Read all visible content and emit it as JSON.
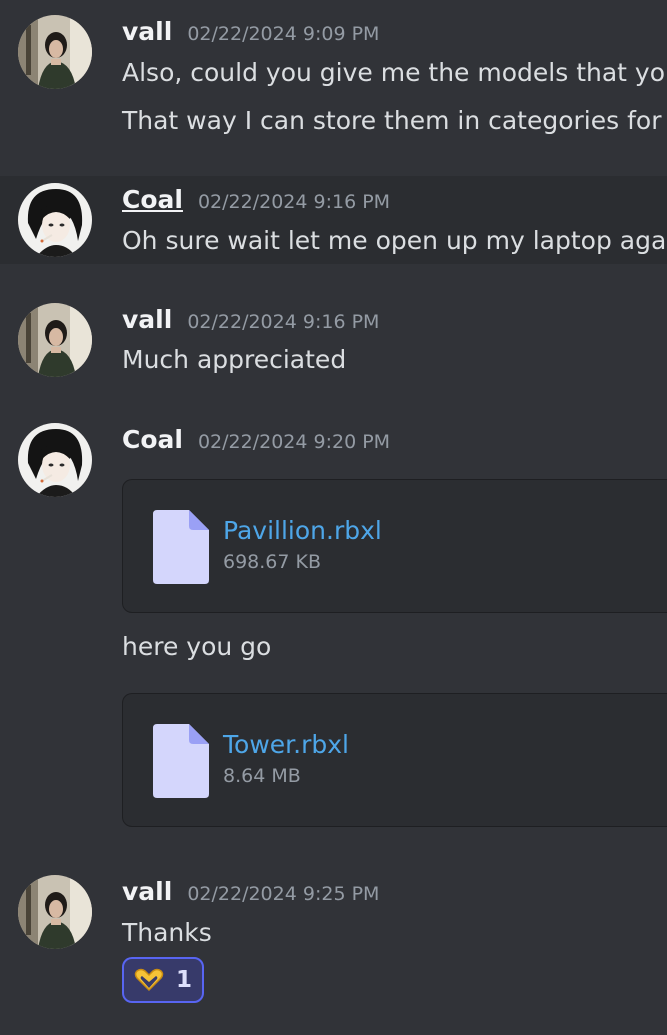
{
  "messages": [
    {
      "author": "vall",
      "timestamp": "02/22/2024 9:09 PM",
      "lines": [
        "Also, could you give me the models that you",
        "That way I can store them in categories for r"
      ]
    },
    {
      "author": "Coal",
      "timestamp": "02/22/2024 9:16 PM",
      "lines": [
        "Oh sure wait let me open up my laptop agair"
      ]
    },
    {
      "author": "vall",
      "timestamp": "02/22/2024 9:16 PM",
      "lines": [
        "Much appreciated"
      ]
    },
    {
      "author": "Coal",
      "timestamp": "02/22/2024 9:20 PM",
      "attachments": [
        {
          "name": "Pavillion.rbxl",
          "size": "698.67 KB",
          "icon": "file-icon"
        },
        {
          "name": "Tower.rbxl",
          "size": "8.64 MB",
          "icon": "file-icon"
        }
      ],
      "lines": [
        "here you go"
      ]
    },
    {
      "author": "vall",
      "timestamp": "02/22/2024 9:25 PM",
      "lines": [
        "Thanks"
      ],
      "reaction": {
        "emoji": "heart-hands-emoji",
        "count": "1"
      }
    }
  ],
  "colors": {
    "background": "#313338",
    "highlight": "#2b2d31",
    "link": "#4ea6e8",
    "reaction_accent": "#5865f2"
  }
}
